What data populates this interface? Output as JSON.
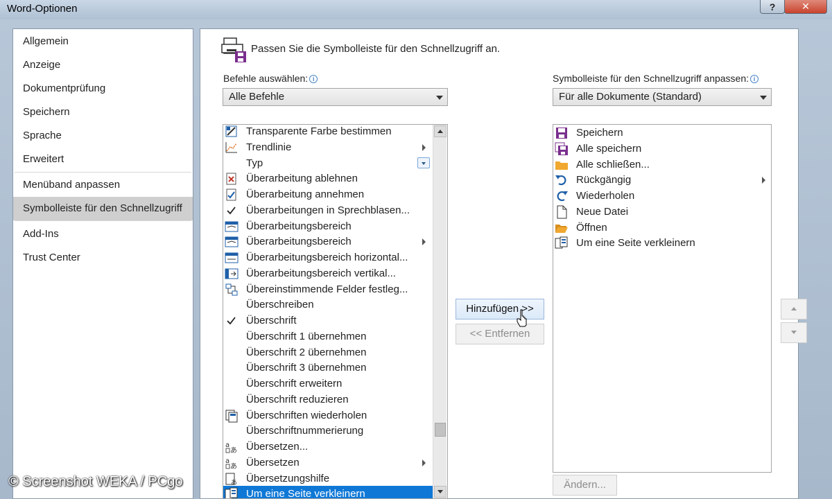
{
  "window": {
    "title": "Word-Optionen",
    "help_label": "?",
    "close_label": "✕"
  },
  "sidebar": {
    "items": [
      {
        "label": "Allgemein"
      },
      {
        "label": "Anzeige"
      },
      {
        "label": "Dokumentprüfung"
      },
      {
        "label": "Speichern"
      },
      {
        "label": "Sprache"
      },
      {
        "label": "Erweitert"
      },
      {
        "label": "Menüband anpassen"
      },
      {
        "label": "Symbolleiste für den Schnellzugriff",
        "selected": true
      },
      {
        "label": "Add-Ins"
      },
      {
        "label": "Trust Center"
      }
    ]
  },
  "main": {
    "header": "Passen Sie die Symbolleiste für den Schnellzugriff an.",
    "commands_label": "Befehle auswählen:",
    "commands_select_value": "Alle Befehle",
    "toolbar_label": "Symbolleiste für den Schnellzugriff anpassen:",
    "toolbar_select_value": "Für alle Dokumente (Standard)",
    "commands": [
      {
        "label": "Transparente Farbe bestimmen",
        "icon": "transparent-color-icon"
      },
      {
        "label": "Trendlinie",
        "icon": "trendline-icon",
        "submenu": true
      },
      {
        "label": "Typ",
        "icon": "",
        "dropdown": true
      },
      {
        "label": "Überarbeitung ablehnen",
        "icon": "reject-change-icon"
      },
      {
        "label": "Überarbeitung annehmen",
        "icon": "accept-change-icon"
      },
      {
        "label": "Überarbeitungen in Sprechblasen...",
        "icon": "checkmark-icon"
      },
      {
        "label": "Überarbeitungsbereich",
        "icon": "reviewing-pane-icon"
      },
      {
        "label": "Überarbeitungsbereich",
        "icon": "reviewing-pane-icon",
        "submenu": true
      },
      {
        "label": "Überarbeitungsbereich horizontal...",
        "icon": "reviewing-pane-horizontal-icon"
      },
      {
        "label": "Überarbeitungsbereich vertikal...",
        "icon": "reviewing-pane-vertical-icon"
      },
      {
        "label": "Übereinstimmende Felder festleg...",
        "icon": "match-fields-icon"
      },
      {
        "label": "Überschreiben",
        "icon": ""
      },
      {
        "label": "Überschrift",
        "icon": "checkmark-icon"
      },
      {
        "label": "Überschrift 1 übernehmen",
        "icon": ""
      },
      {
        "label": "Überschrift 2 übernehmen",
        "icon": ""
      },
      {
        "label": "Überschrift 3 übernehmen",
        "icon": ""
      },
      {
        "label": "Überschrift erweitern",
        "icon": ""
      },
      {
        "label": "Überschrift reduzieren",
        "icon": ""
      },
      {
        "label": "Überschriften wiederholen",
        "icon": "repeat-headings-icon"
      },
      {
        "label": "Überschriftnummerierung",
        "icon": ""
      },
      {
        "label": "Übersetzen...",
        "icon": "translate-icon"
      },
      {
        "label": "Übersetzen",
        "icon": "translate-icon",
        "submenu": true
      },
      {
        "label": "Übersetzungshilfe",
        "icon": "translate-helper-icon"
      },
      {
        "label": "Um eine Seite verkleinern",
        "icon": "shrink-page-icon",
        "selected": true
      }
    ],
    "toolbar_items": [
      {
        "label": "Speichern",
        "icon": "save-icon"
      },
      {
        "label": "Alle speichern",
        "icon": "save-all-icon"
      },
      {
        "label": "Alle schließen...",
        "icon": "folder-icon"
      },
      {
        "label": "Rückgängig",
        "icon": "undo-icon",
        "submenu": true
      },
      {
        "label": "Wiederholen",
        "icon": "redo-icon"
      },
      {
        "label": "Neue Datei",
        "icon": "new-file-icon"
      },
      {
        "label": "Öffnen",
        "icon": "open-folder-icon"
      },
      {
        "label": "Um eine Seite verkleinern",
        "icon": "shrink-page-icon"
      }
    ],
    "add_button": "Hinzufügen >>",
    "remove_button": "<< Entfernen",
    "modify_button": "Ändern..."
  },
  "watermark": "© Screenshot WEKA / PCgo",
  "colors": {
    "selection": "#0f78d7",
    "save_purple": "#7a2f8e",
    "folder_orange": "#f0a830",
    "undo_blue": "#1f5fa8"
  }
}
